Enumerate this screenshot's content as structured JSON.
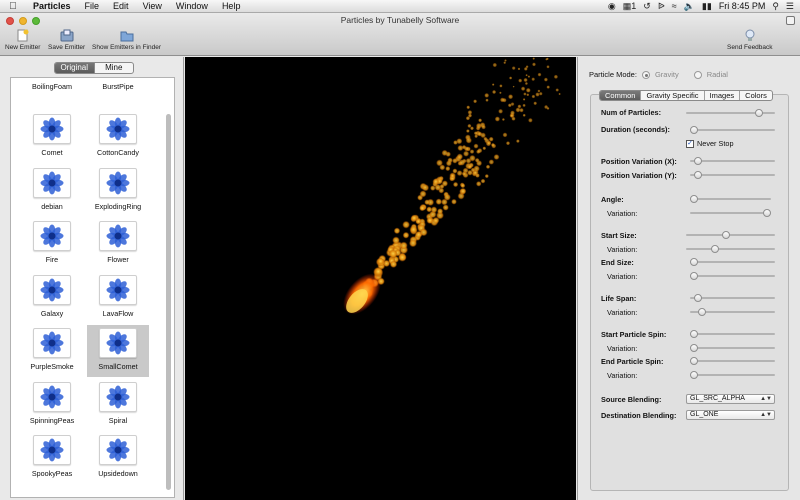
{
  "menubar": {
    "app_name": "Particles",
    "menus": [
      "File",
      "Edit",
      "View",
      "Window",
      "Help"
    ],
    "badge": "1",
    "clock": "Fri 8:45 PM"
  },
  "window": {
    "title": "Particles by Tunabelly Software",
    "toolbar": {
      "new_emitter": "New Emitter",
      "save_emitter": "Save Emitter",
      "show_in_finder": "Show Emitters in Finder",
      "send_feedback": "Send Feedback"
    }
  },
  "library": {
    "segments": [
      "Original",
      "Mine"
    ],
    "active_segment": "Original",
    "top_labels": [
      "BoilingFoam",
      "BurstPipe"
    ],
    "items": [
      "Comet",
      "CottonCandy",
      "debian",
      "ExplodingRing",
      "Fire",
      "Flower",
      "Galaxy",
      "LavaFlow",
      "PurpleSmoke",
      "SmallComet",
      "SpinningPeas",
      "Spiral",
      "SpookyPeas",
      "Upsidedown"
    ],
    "selected": "SmallComet"
  },
  "inspector": {
    "particle_mode_label": "Particle Mode:",
    "mode_gravity": "Gravity",
    "mode_radial": "Radial",
    "selected_mode": "Gravity",
    "tabs": [
      "Common",
      "Gravity Specific",
      "Images",
      "Colors"
    ],
    "active_tab": "Common",
    "labels": {
      "num_particles": "Num of Particles:",
      "duration": "Duration (seconds):",
      "never_stop": "Never Stop",
      "pos_var_x": "Position Variation (X):",
      "pos_var_y": "Position Variation (Y):",
      "angle": "Angle:",
      "variation": "Variation:",
      "start_size": "Start Size:",
      "end_size": "End Size:",
      "life_span": "Life Span:",
      "start_spin": "Start Particle Spin:",
      "end_spin": "End Particle Spin:",
      "source_blending": "Source Blending:",
      "destination_blending": "Destination Blending:"
    },
    "never_stop_checked": true,
    "source_blending_value": "GL_SRC_ALPHA",
    "destination_blending_value": "GL_ONE",
    "slider_levels": {
      "num_particles": 0.85,
      "duration": 0.0,
      "pos_var_x": 0.05,
      "pos_var_y": 0.05,
      "angle": 0.0,
      "angle_variation": 1.0,
      "start_size": 0.45,
      "start_size_variation": 0.31,
      "end_size": 0.0,
      "end_size_variation": 0.0,
      "life_span": 0.05,
      "life_span_variation": 0.1,
      "start_spin": 0.0,
      "start_spin_variation": 0.0,
      "end_spin": 0.0,
      "end_spin_variation": 0.0
    }
  },
  "colors": {
    "emitter_icon_blue": "#2e5fd6",
    "flame_core": "#ff5a00",
    "flame_glow": "#ffb21f",
    "selection": "#c9c9c9"
  }
}
